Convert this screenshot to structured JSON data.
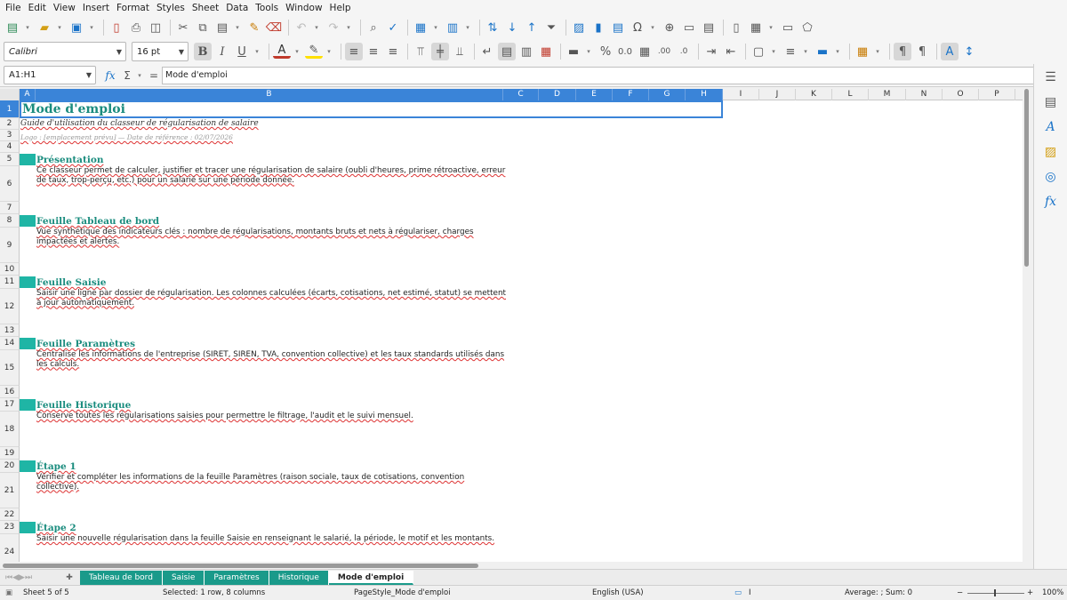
{
  "menu": [
    "File",
    "Edit",
    "View",
    "Insert",
    "Format",
    "Styles",
    "Sheet",
    "Data",
    "Tools",
    "Window",
    "Help"
  ],
  "format_bar": {
    "font_name": "Calibri",
    "font_size": "16 pt"
  },
  "formula_bar": {
    "cell_ref": "A1:H1",
    "function_symbol": "fx",
    "sum_symbol": "Σ",
    "equals_symbol": "=",
    "content": "Mode d'emploi"
  },
  "columns": [
    "A",
    "B",
    "C",
    "D",
    "E",
    "F",
    "G",
    "H",
    "I",
    "J",
    "K",
    "L",
    "M",
    "N",
    "O",
    "P"
  ],
  "rows": [
    "1",
    "2",
    "3",
    "4",
    "5",
    "6",
    "7",
    "8",
    "9",
    "10",
    "11",
    "12",
    "13",
    "14",
    "15",
    "16",
    "17",
    "18",
    "19",
    "20",
    "21",
    "22",
    "23",
    "24"
  ],
  "sheet": {
    "title": "Mode d'emploi",
    "subtitle": "Guide d'utilisation du classeur de régularisation de salaire",
    "meta": "Logo : [emplacement prévu] — Date de référence : 02/07/2026",
    "sections": [
      {
        "title": "Présentation",
        "body": "Ce classeur permet de calculer, justifier et tracer une régularisation de salaire (oubli d'heures, prime rétroactive, erreur de taux, trop-perçu, etc.) pour un salarié sur une période donnée."
      },
      {
        "title": "Feuille Tableau de bord",
        "body": "Vue synthétique des indicateurs clés : nombre de régularisations, montants bruts et nets à régulariser, charges impactées et alertes."
      },
      {
        "title": "Feuille Saisie",
        "body": "Saisir une ligne par dossier de régularisation. Les colonnes calculées (écarts, cotisations, net estimé, statut) se mettent à jour automatiquement."
      },
      {
        "title": "Feuille Paramètres",
        "body": "Centralise les informations de l'entreprise (SIRET, SIREN, TVA, convention collective) et les taux standards utilisés dans les calculs."
      },
      {
        "title": "Feuille Historique",
        "body": "Conserve toutes les régularisations saisies pour permettre le filtrage, l'audit et le suivi mensuel."
      },
      {
        "title": "Étape 1",
        "body": "Vérifier et compléter les informations de la feuille Paramètres (raison sociale, taux de cotisations, convention collective)."
      },
      {
        "title": "Étape 2",
        "body": "Saisir une nouvelle régularisation dans la feuille Saisie en renseignant le salarié, la période, le motif et les montants."
      }
    ]
  },
  "tabs": [
    "Tableau de bord",
    "Saisie",
    "Paramètres",
    "Historique",
    "Mode d'emploi"
  ],
  "active_tab": "Mode d'emploi",
  "status": {
    "sheet": "Sheet 5 of 5",
    "selection": "Selected: 1 row, 8 columns",
    "page_style": "PageStyle_Mode d'emploi",
    "language": "English (USA)",
    "aggregate": "Average: ; Sum: 0",
    "zoom": "100%"
  },
  "colors": {
    "accent": "#1a9a8a",
    "title": "#1a8c7e",
    "selection": "#3a84d8"
  }
}
